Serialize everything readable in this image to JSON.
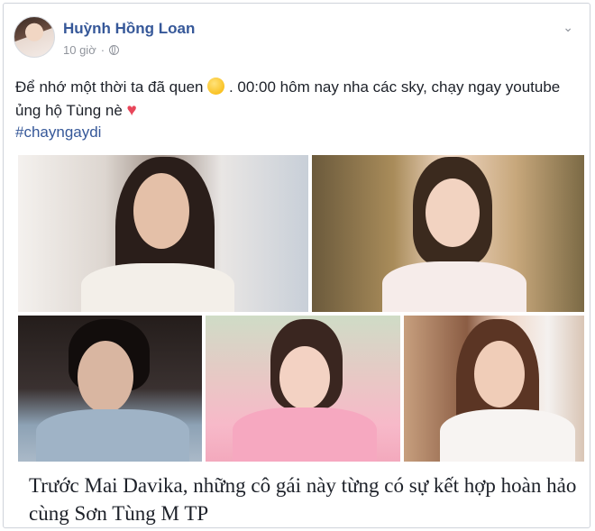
{
  "post": {
    "author": "Huỳnh Hồng Loan",
    "time": "10 giờ",
    "text_part1": "Để nhớ một thời ta đã quen",
    "text_part2": ". 00:00 hôm nay nha các sky, chạy ngay youtube ủng hộ Tùng nè",
    "hashtag": "#chayngaydi",
    "emoji_smile": "smile-emoji",
    "emoji_heart": "heart-emoji"
  },
  "link": {
    "title": "Trước Mai Davika, những cô gái này từng có sự kết hợp hoàn hảo cùng Sơn Tùng M TP"
  },
  "colors": {
    "author": "#365899",
    "hashtag": "#365899",
    "meta": "#90949c",
    "text": "#1d2129"
  }
}
